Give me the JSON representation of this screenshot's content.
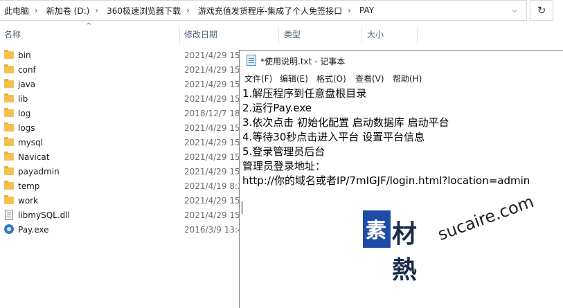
{
  "address_bar": {
    "crumbs": [
      "此电脑",
      "新加卷 (D:)",
      "360极速浏览器下载",
      "游戏充值发货程序-集成了个人免签接口",
      "PAY"
    ],
    "dropdown_glyph": "⌵",
    "refresh_glyph": "↻"
  },
  "columns": {
    "name": "名称",
    "modified": "修改日期",
    "type": "类型",
    "size": "大小"
  },
  "files": [
    {
      "name": "bin",
      "date": "2021/4/29 15:",
      "kind": "folder"
    },
    {
      "name": "conf",
      "date": "2021/4/29 15:",
      "kind": "folder"
    },
    {
      "name": "java",
      "date": "2021/4/29 15:",
      "kind": "folder"
    },
    {
      "name": "lib",
      "date": "2021/4/29 15:",
      "kind": "folder"
    },
    {
      "name": "log",
      "date": "2018/12/7 18:",
      "kind": "folder"
    },
    {
      "name": "logs",
      "date": "2021/4/29 15:",
      "kind": "folder"
    },
    {
      "name": "mysql",
      "date": "2021/4/29 15:",
      "kind": "folder"
    },
    {
      "name": "Navicat",
      "date": "2021/4/29 15:",
      "kind": "folder"
    },
    {
      "name": "payadmin",
      "date": "2021/4/29 15:",
      "kind": "folder"
    },
    {
      "name": "temp",
      "date": "2021/4/19 8:2",
      "kind": "folder"
    },
    {
      "name": "work",
      "date": "2021/4/29 15:",
      "kind": "folder"
    },
    {
      "name": "libmySQL.dll",
      "date": "2021/4/29 15:",
      "kind": "dll"
    },
    {
      "name": "Pay.exe",
      "date": "2016/3/9 13:4",
      "kind": "exe"
    }
  ],
  "notepad": {
    "title": "*使用说明.txt - 记事本",
    "menus": [
      "文件(F)",
      "编辑(E)",
      "格式(O)",
      "查看(V)",
      "帮助(H)"
    ],
    "lines": [
      "1.解压程序到任意盘根目录",
      "2.运行Pay.exe",
      "3.依次点击 初始化配置 启动数据库 启动平台",
      "4.等待30秒点击进入平台 设置平台信息",
      "5.登录管理员后台",
      "管理员登录地址：",
      "http://你的域名或者IP/7mIGJF/login.html?location=admin"
    ]
  },
  "watermark": {
    "glyph": "素",
    "cn": "材熱",
    "en": "sucaire.com"
  }
}
